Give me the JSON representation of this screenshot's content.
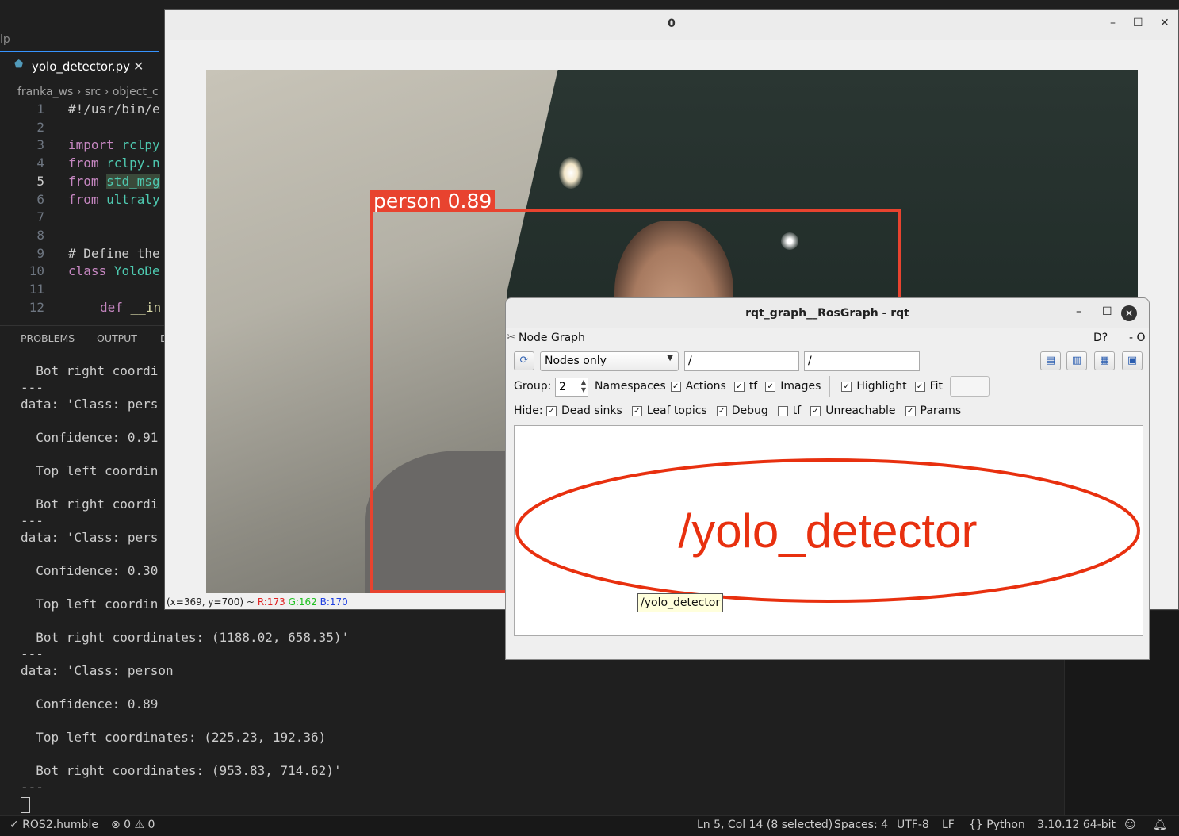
{
  "vscode": {
    "menu_fragment": "lp",
    "tab": {
      "label": "yolo_detector.py",
      "close": "✕"
    },
    "breadcrumb": [
      "franka_ws",
      "src",
      "object_c"
    ],
    "code_lines": [
      {
        "n": "1",
        "text": "#!/usr/bin/e"
      },
      {
        "n": "2",
        "text": ""
      },
      {
        "n": "3",
        "text": "import rclpy"
      },
      {
        "n": "4",
        "text": "from rclpy.n"
      },
      {
        "n": "5",
        "text": "from std_msg"
      },
      {
        "n": "6",
        "text": "from ultraly"
      },
      {
        "n": "7",
        "text": ""
      },
      {
        "n": "8",
        "text": ""
      },
      {
        "n": "9",
        "text": "# Define the"
      },
      {
        "n": "10",
        "text": "class YoloDe"
      },
      {
        "n": "11",
        "text": ""
      },
      {
        "n": "12",
        "text": "def __in"
      }
    ],
    "panel_tabs": [
      "PROBLEMS",
      "OUTPUT",
      "D"
    ],
    "terminal_lines": [
      "  Bot right coordi",
      "---",
      "data: 'Class: pers",
      "",
      "  Confidence: 0.91",
      "",
      "  Top left coordin",
      "",
      "  Bot right coordi",
      "---",
      "data: 'Class: pers",
      "",
      "  Confidence: 0.30",
      "",
      "  Top left coordin",
      "",
      "  Bot right coordinates: (1188.02, 658.35)'",
      "---",
      "data: 'Class: person",
      "",
      "  Confidence: 0.89",
      "",
      "  Top left coordinates: (225.23, 192.36)",
      "",
      "  Bot right coordinates: (953.83, 714.62)'",
      "---"
    ],
    "status": {
      "branch": "✓ ROS2.humble",
      "problems": "⊗ 0 ⚠ 0",
      "position": "Ln 5, Col 14 (8 selected)",
      "spaces": "Spaces: 4",
      "encoding": "UTF-8",
      "eol": "LF",
      "language": "{} Python",
      "interpreter": "3.10.12 64-bit"
    }
  },
  "cv_window": {
    "title": "0",
    "controls": {
      "minimize": "–",
      "maximize": "☐",
      "close": "✕"
    },
    "detection_label": "person 0.89",
    "status": {
      "pos": "(x=369, y=700) ~",
      "r": "R:173",
      "g": "G:162",
      "b": "B:170"
    },
    "colors": {
      "box": "#e8432f"
    }
  },
  "rqt": {
    "title": "rqt_graph__RosGraph - rqt",
    "controls": {
      "minimize": "–",
      "maximize": "☐",
      "close": "✕"
    },
    "plugin_title": "Node Graph",
    "plugin_extra": "D?",
    "plugin_min": "- O",
    "combo_value": "Nodes only",
    "filter1": "/",
    "filter2": "/",
    "group_label": "Group:",
    "group_value": "2",
    "row1_checks": [
      {
        "label": "Namespaces",
        "checked": false,
        "box_only": false
      },
      {
        "label": "Actions",
        "checked": true
      },
      {
        "label": "tf",
        "checked": true
      },
      {
        "label": "Images",
        "checked": true
      },
      {
        "label": "Highlight",
        "checked": true
      },
      {
        "label": "Fit",
        "checked": true
      }
    ],
    "hide_label": "Hide:",
    "hide_checks": [
      {
        "label": "Dead sinks",
        "checked": true
      },
      {
        "label": "Leaf topics",
        "checked": true
      },
      {
        "label": "Debug",
        "checked": true
      },
      {
        "label": "tf",
        "checked": false
      },
      {
        "label": "Unreachable",
        "checked": true
      },
      {
        "label": "Params",
        "checked": true
      }
    ],
    "graph_node": "/yolo_detector",
    "tooltip": "/yolo_detector",
    "colors": {
      "node": "#e8300f"
    }
  }
}
